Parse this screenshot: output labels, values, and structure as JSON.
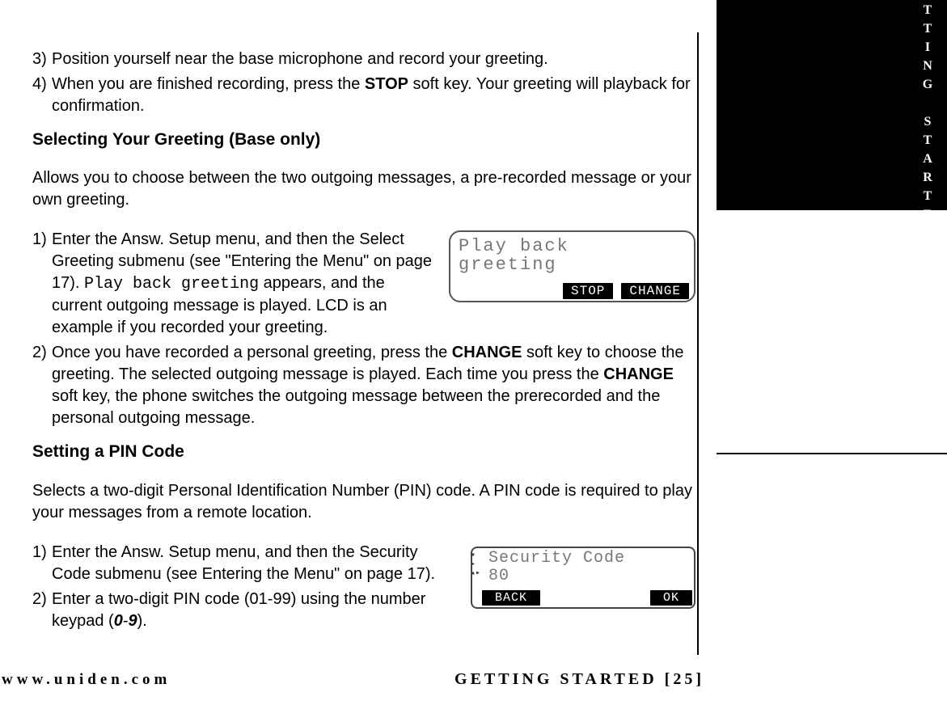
{
  "sideTab": "GETTING STARTED",
  "steps_a": {
    "3": "Position yourself near the base microphone and record your greeting.",
    "4a": "When you are finished recording, press the ",
    "4b": "STOP",
    "4c": " soft key. Your greeting will playback for confirmation."
  },
  "heading1": "Selecting Your Greeting (Base only)",
  "para1": "Allows you to choose between the two outgoing messages, a pre-recorded message or your own greeting.",
  "steps_b": {
    "1a": "Enter the Answ. Setup menu, and then the Select Greeting submenu (see \"Entering the Menu\" on page 17). ",
    "1lcd": "Play back greeting",
    "1b": " appears, and the current outgoing message is played. LCD is an example if you recorded your greeting.",
    "2a": "Once you have recorded a personal greeting, press the ",
    "2b": "CHANGE",
    "2c": " soft key to choose the greeting. The selected outgoing message is played. Each time you press the ",
    "2d": "CHANGE",
    "2e": " soft key, the phone switches the outgoing message between the prerecorded and the personal outgoing message."
  },
  "heading2": "Setting a PIN Code",
  "para2": "Selects a two-digit Personal Identification Number (PIN) code. A PIN code is required to play your messages from a remote location.",
  "steps_c": {
    "1": "Enter the Answ. Setup menu, and then the Security Code submenu (see Entering the Menu\" on page 17).",
    "2a": "Enter a two-digit PIN code (01-99) using the number keypad (",
    "2b": "0",
    "2c": "-",
    "2d": "9",
    "2e": ")."
  },
  "lcd1": {
    "line1": "Play back",
    "line2": "greeting",
    "soft1": "STOP",
    "soft2": "CHANGE"
  },
  "lcd2": {
    "line1": "Security Code",
    "line2": "80",
    "soft1": "BACK",
    "soft2": "OK"
  },
  "footer": {
    "left": "www.uniden.com",
    "right": "GETTING STARTED [25]"
  }
}
